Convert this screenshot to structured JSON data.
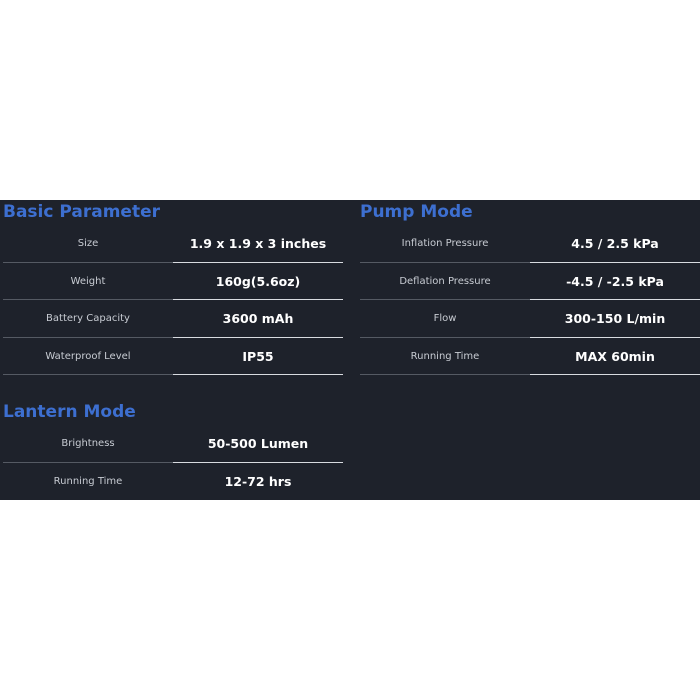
{
  "basic_parameter": {
    "title": "Basic Parameter",
    "rows": [
      {
        "label": "Size",
        "value": "1.9 x 1.9 x 3 inches"
      },
      {
        "label": "Weight",
        "value": "160g(5.6oz)"
      },
      {
        "label": "Battery Capacity",
        "value": "3600 mAh"
      },
      {
        "label": "Waterproof Level",
        "value": "IP55"
      }
    ]
  },
  "pump_mode": {
    "title": "Pump Mode",
    "rows": [
      {
        "label": "Inflation Pressure",
        "value": "4.5 / 2.5 kPa"
      },
      {
        "label": "Deflation Pressure",
        "value": "-4.5 / -2.5 kPa"
      },
      {
        "label": "Flow",
        "value": "300-150 L/min"
      },
      {
        "label": "Running Time",
        "value": "MAX 60min"
      }
    ]
  },
  "lantern_mode": {
    "title": "Lantern Mode",
    "rows": [
      {
        "label": "Brightness",
        "value": "50-500 Lumen"
      },
      {
        "label": "Running Time",
        "value": "12-72 hrs"
      }
    ]
  },
  "colors": {
    "panel_background": "#1e222b",
    "heading_blue": "#3d6fd0",
    "label_text": "#c8ccd3",
    "value_text": "#ffffff"
  }
}
